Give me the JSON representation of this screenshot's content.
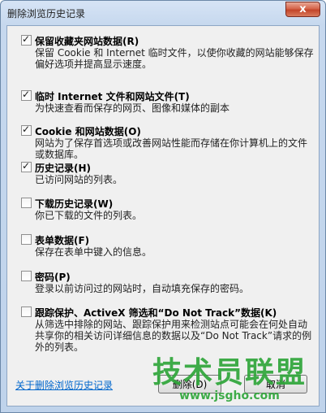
{
  "window": {
    "title": "删除浏览历史记录",
    "close_glyph": "x"
  },
  "items": [
    {
      "checked": true,
      "label": "保留收藏夹网站数据(R)",
      "desc": "保留 Cookie 和 Internet 临时文件，以使你收藏的网站能够保存偏好选项并提高显示速度。"
    },
    {
      "checked": true,
      "label": "临时 Internet 文件和网站文件(T)",
      "desc": "为快速查看而保存的网页、图像和媒体的副本"
    },
    {
      "checked": true,
      "label": "Cookie 和网站数据(O)",
      "desc": "网站为了保存首选项或改善网站性能而存储在你计算机上的文件或数据库。"
    },
    {
      "checked": true,
      "label": "历史记录(H)",
      "desc": "已访问网站的列表。"
    },
    {
      "checked": false,
      "label": "下载历史记录(W)",
      "desc": "你已下载的文件的列表。"
    },
    {
      "checked": false,
      "label": "表单数据(F)",
      "desc": "保存在表单中键入的信息。"
    },
    {
      "checked": false,
      "label": "密码(P)",
      "desc": "登录以前访问过的网站时，自动填充保存的密码。"
    },
    {
      "checked": false,
      "label": "跟踪保护、ActiveX 筛选和“Do Not Track”数据(K)",
      "desc": "从筛选中排除的网站、跟踪保护用来检测站点可能会在何处自动共享你的相关访问详细信息的数据以及“Do Not Track”请求的例外的列表。"
    }
  ],
  "footer": {
    "link": "关于删除浏览历史记录",
    "delete_label": "删除(D)",
    "cancel_label": "取消"
  },
  "watermark": {
    "text": "技术员联盟",
    "url": "www.jsgho.com"
  }
}
